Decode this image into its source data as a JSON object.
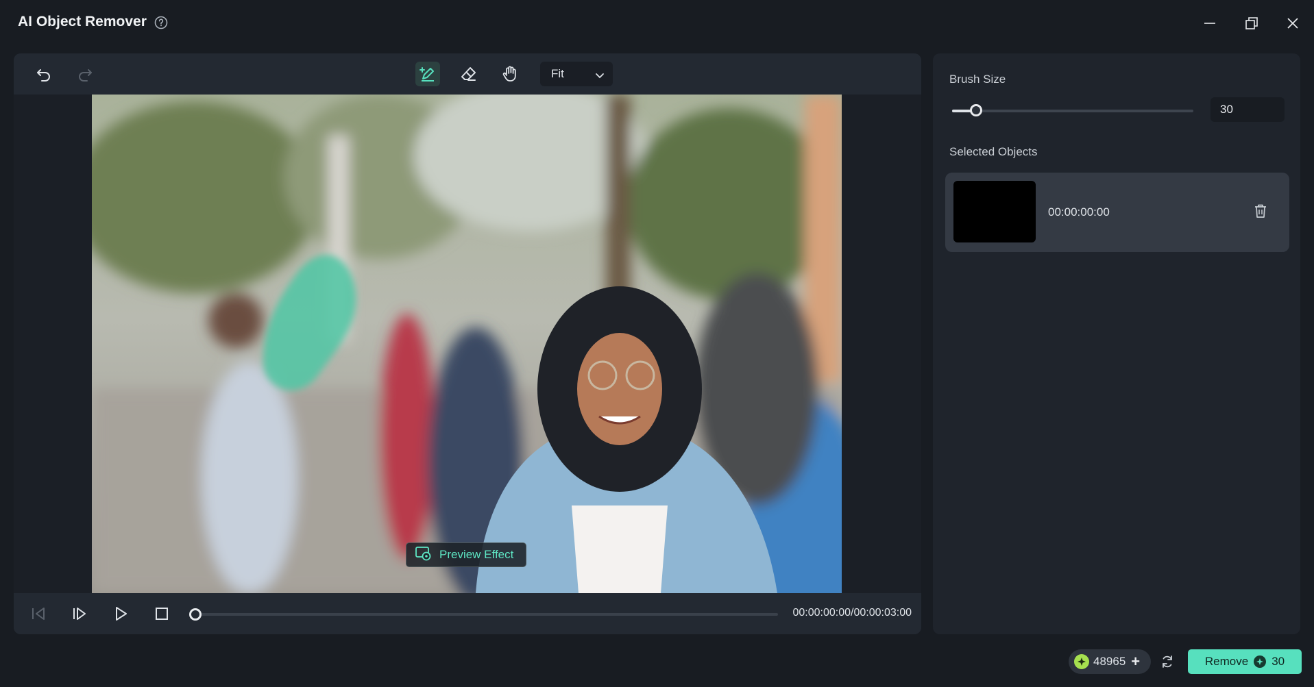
{
  "window": {
    "title": "AI Object Remover",
    "help_icon": "help-circle-icon",
    "controls": [
      "minimize-icon",
      "restore-icon",
      "close-icon"
    ]
  },
  "toolbar": {
    "undo_icon": "undo-icon",
    "redo_icon": "redo-icon",
    "tools": [
      "brush-add-icon",
      "eraser-icon",
      "hand-pan-icon"
    ],
    "active_tool": "brush-add-icon",
    "zoom_value": "Fit"
  },
  "canvas": {
    "preview_label": "Preview Effect",
    "accent_color": "#57e0be"
  },
  "playback": {
    "timecode": "00:00:00:00/00:00:03:00",
    "progress": 0
  },
  "side": {
    "brush_label": "Brush Size",
    "brush_value": "30",
    "brush_fraction": 0.1,
    "selected_label": "Selected Objects",
    "objects": [
      {
        "time": "00:00:00:00"
      }
    ]
  },
  "footer": {
    "credits": "48965",
    "remove_label": "Remove",
    "remove_cost": "30"
  }
}
